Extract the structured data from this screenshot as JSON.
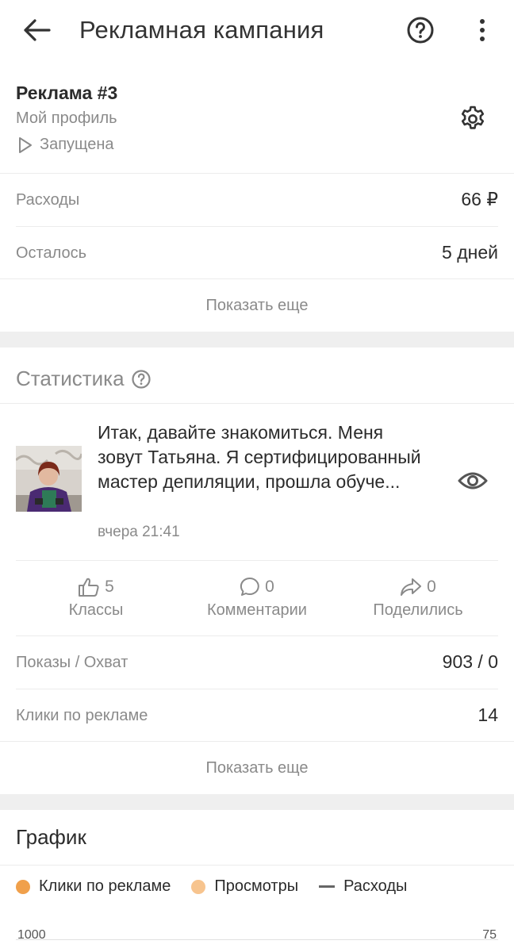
{
  "appbar": {
    "title": "Рекламная кампания",
    "back_icon": "arrow-left-icon",
    "help_icon": "help-circle-icon",
    "more_icon": "more-vertical-icon"
  },
  "ad": {
    "name": "Реклама #3",
    "target": "Мой профиль",
    "status": "Запущена",
    "status_icon": "play-outline-icon",
    "settings_icon": "gear-icon"
  },
  "summary": {
    "rows": [
      {
        "label": "Расходы",
        "value": "66 ₽"
      },
      {
        "label": "Осталось",
        "value": "5 дней"
      }
    ],
    "show_more": "Показать еще"
  },
  "statistics": {
    "title": "Статистика",
    "post": {
      "text": "Итак, давайте знакомиться. Меня зовут Татьяна. Я сертифицированный мастер депиляции, прошла обуче...",
      "time": "вчера 21:41",
      "view_icon": "eye-icon"
    },
    "reactions": [
      {
        "count": "5",
        "label": "Классы",
        "icon": "thumbs-up-icon"
      },
      {
        "count": "0",
        "label": "Комментарии",
        "icon": "comment-icon"
      },
      {
        "count": "0",
        "label": "Поделились",
        "icon": "share-arrow-icon"
      }
    ],
    "rows": [
      {
        "label": "Показы / Охват",
        "value": "903 / 0"
      },
      {
        "label": "Клики по рекламе",
        "value": "14"
      }
    ],
    "show_more": "Показать еще"
  },
  "chart": {
    "title": "График",
    "legend": [
      {
        "label": "Клики по рекламе",
        "color": "#f0a04b"
      },
      {
        "label": "Просмотры",
        "color": "#f7c48e"
      },
      {
        "label": "Расходы",
        "color": "#666666"
      }
    ],
    "left_axis_top": "1000",
    "right_axis_top": "75"
  },
  "colors": {
    "text": "#2b2b2b",
    "muted": "#8a8a8a",
    "divider": "#ececec",
    "section_gap": "#efefef"
  }
}
